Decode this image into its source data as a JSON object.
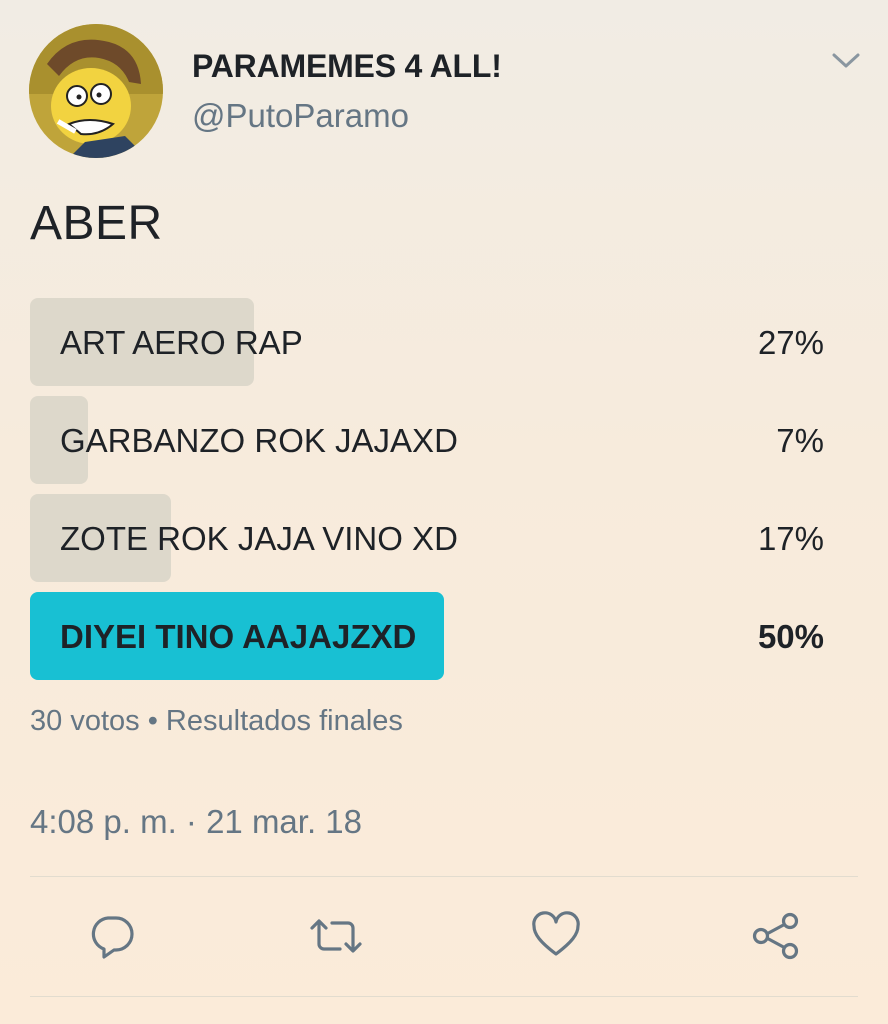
{
  "user": {
    "display_name": "PARAMEMES 4 ALL!",
    "handle": "@PutoParamo"
  },
  "tweet": {
    "text": "ABER",
    "timestamp": "4:08 p. m. · 21 mar. 18"
  },
  "poll": {
    "options": [
      {
        "label": "ART AERO RAP",
        "percent": 27,
        "percent_label": "27%",
        "winner": false
      },
      {
        "label": "GARBANZO ROK JAJAXD",
        "percent": 7,
        "percent_label": "7%",
        "winner": false
      },
      {
        "label": "ZOTE ROK JAJA VINO XD",
        "percent": 17,
        "percent_label": "17%",
        "winner": false
      },
      {
        "label": "DIYEI TINO AAJAJZXD",
        "percent": 50,
        "percent_label": "50%",
        "winner": true
      }
    ],
    "votes_label": "30 votos",
    "separator": "•",
    "status_label": "Resultados finales",
    "meta_text": "30 votos • Resultados finales"
  },
  "actions": [
    {
      "name": "reply",
      "icon": "reply-icon"
    },
    {
      "name": "retweet",
      "icon": "retweet-icon"
    },
    {
      "name": "like",
      "icon": "heart-icon"
    },
    {
      "name": "share",
      "icon": "share-icon"
    }
  ],
  "colors": {
    "winner_bar": "#18c0d3",
    "bar": "#ddd8cb",
    "secondary_text": "#657684",
    "icon": "#657684"
  }
}
